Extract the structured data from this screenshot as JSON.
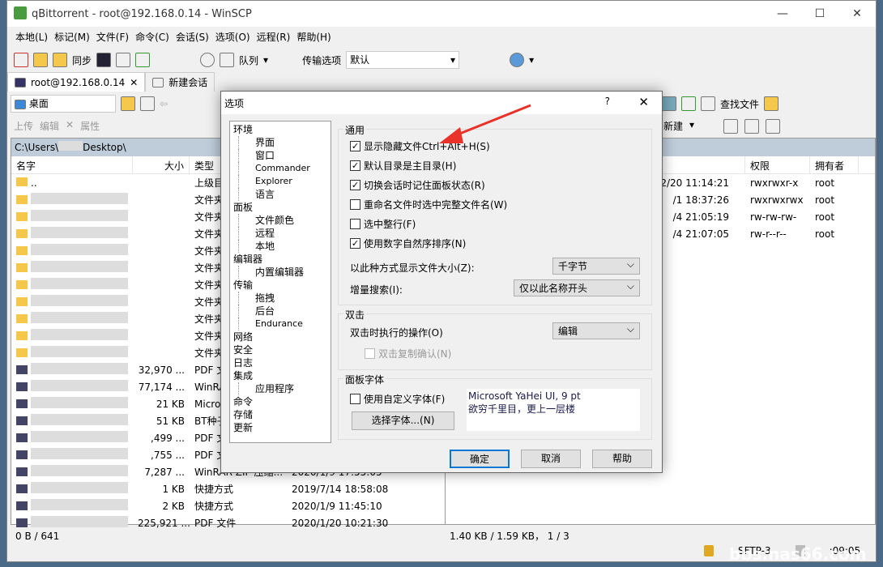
{
  "window": {
    "title": "qBittorrent - root@192.168.0.14 - WinSCP",
    "min": "—",
    "max": "☐",
    "close": "✕"
  },
  "menu": [
    "本地(L)",
    "标记(M)",
    "文件(F)",
    "命令(C)",
    "会话(S)",
    "选项(O)",
    "远程(R)",
    "帮助(H)"
  ],
  "toolbar": {
    "sync": "同步",
    "queue": "队列",
    "transfer_label": "传输选项",
    "transfer_value": "默认"
  },
  "tabs": [
    {
      "label": "root@192.168.0.14",
      "close": "✕"
    },
    {
      "label": "新建会话"
    }
  ],
  "left": {
    "location": "桌面",
    "upload": "上传",
    "edit": "编辑",
    "props": "属性",
    "path": "C:\\Users\\",
    "path_end": "Desktop\\",
    "headers": [
      "名字",
      "大小",
      "类型"
    ],
    "rows": [
      {
        "name": "..",
        "size": "",
        "type": "上级目录",
        "date": ""
      },
      {
        "size": "",
        "type": "文件夹",
        "date": ""
      },
      {
        "size": "",
        "type": "文件夹",
        "date": ""
      },
      {
        "size": "",
        "type": "文件夹",
        "date": ""
      },
      {
        "size": "",
        "type": "文件夹",
        "date": ""
      },
      {
        "size": "",
        "type": "文件夹",
        "date": ""
      },
      {
        "size": "",
        "type": "文件夹",
        "date": ""
      },
      {
        "size": "",
        "type": "文件夹",
        "date": ""
      },
      {
        "size": "",
        "type": "文件夹",
        "date": ""
      },
      {
        "size": "",
        "type": "文件夹",
        "date": ""
      },
      {
        "size": "",
        "type": "文件夹",
        "date": ""
      },
      {
        "size": "32,970 ...",
        "type": "PDF 文",
        "date": ""
      },
      {
        "size": "77,174 ...",
        "type": "WinRA",
        "date": ""
      },
      {
        "size": "21 KB",
        "type": "Micros",
        "date": ""
      },
      {
        "size": "51 KB",
        "type": "BT种子",
        "date": ""
      },
      {
        "size": ",499 ...",
        "type": "PDF 文",
        "date": ""
      },
      {
        "size": ",755 ...",
        "type": "PDF 文",
        "date": ""
      },
      {
        "size": "7,287 ...",
        "type": "WinRAR ZIP 压缩...",
        "date": "2020/1/9  17:55:05"
      },
      {
        "size": "1 KB",
        "type": "快捷方式",
        "date": "2019/7/14  18:58:08"
      },
      {
        "size": "2 KB",
        "type": "快捷方式",
        "date": "2020/1/9  11:45:10"
      },
      {
        "size": "225,921 ...",
        "type": "PDF 文件",
        "date": "2020/1/20  10:21:30"
      }
    ],
    "status": "0 B / 641"
  },
  "right": {
    "find": "查找文件",
    "new": "新建",
    "headers": [
      "权限",
      "拥有者"
    ],
    "rows": [
      {
        "date": "2/20 11:14:21",
        "perm": "rwxrwxr-x",
        "owner": "root"
      },
      {
        "date": "/1 18:37:26",
        "perm": "rwxrwxrwx",
        "owner": "root"
      },
      {
        "date": "/4 21:05:19",
        "perm": "rw-rw-rw-",
        "owner": "root"
      },
      {
        "date": "/4 21:07:05",
        "perm": "rw-r--r--",
        "owner": "root"
      }
    ],
    "status": "1.40 KB / 1.59 KB，  1 / 3"
  },
  "statusbar": {
    "protocol": "SFTP-3",
    "time": ":09:05"
  },
  "dialog": {
    "title": "选项",
    "help": "?",
    "close": "✕",
    "tree": [
      {
        "l": "环境",
        "c": [
          "界面",
          "窗口",
          "Commander",
          "Explorer",
          "语言"
        ]
      },
      {
        "l": "面板",
        "c": [
          "文件颜色",
          "远程",
          "本地"
        ]
      },
      {
        "l": "编辑器",
        "c": [
          "内置编辑器"
        ]
      },
      {
        "l": "传输",
        "c": [
          "拖拽",
          "后台",
          "Endurance"
        ]
      },
      {
        "l": "网络",
        "c": []
      },
      {
        "l": "安全",
        "c": []
      },
      {
        "l": "日志",
        "c": []
      },
      {
        "l": "集成",
        "c": [
          "应用程序"
        ]
      },
      {
        "l": "命令",
        "c": []
      },
      {
        "l": "存储",
        "c": []
      },
      {
        "l": "更新",
        "c": []
      }
    ],
    "general": {
      "title": "通用",
      "checks": [
        {
          "l": "显示隐藏文件Ctrl+Alt+H(S)",
          "v": true
        },
        {
          "l": "默认目录是主目录(H)",
          "v": true
        },
        {
          "l": "切换会话时记住面板状态(R)",
          "v": true
        },
        {
          "l": "重命名文件时选中完整文件名(W)",
          "v": false
        },
        {
          "l": "选中整行(F)",
          "v": false
        },
        {
          "l": "使用数字自然序排序(N)",
          "v": true
        }
      ],
      "size_label": "以此种方式显示文件大小(Z):",
      "size_value": "千字节",
      "search_label": "增量搜索(I):",
      "search_value": "仅以此名称开头"
    },
    "dbl": {
      "title": "双击",
      "label": "双击时执行的操作(O)",
      "value": "编辑",
      "confirm": "双击复制确认(N)"
    },
    "font": {
      "title": "面板字体",
      "custom": "使用自定义字体(F)",
      "choose": "选择字体...(N)",
      "preview1": "Microsoft YaHei UI, 9 pt",
      "preview2": "欲穷千里目，更上一层楼"
    },
    "ok": "确定",
    "cancel": "取消",
    "helpbtn": "帮助"
  },
  "watermark": "bbs.nas66.com",
  "colors": {
    "arrow": "#e8322a",
    "path_bar": "#bfcddb",
    "ok_border": "#0078d7"
  }
}
